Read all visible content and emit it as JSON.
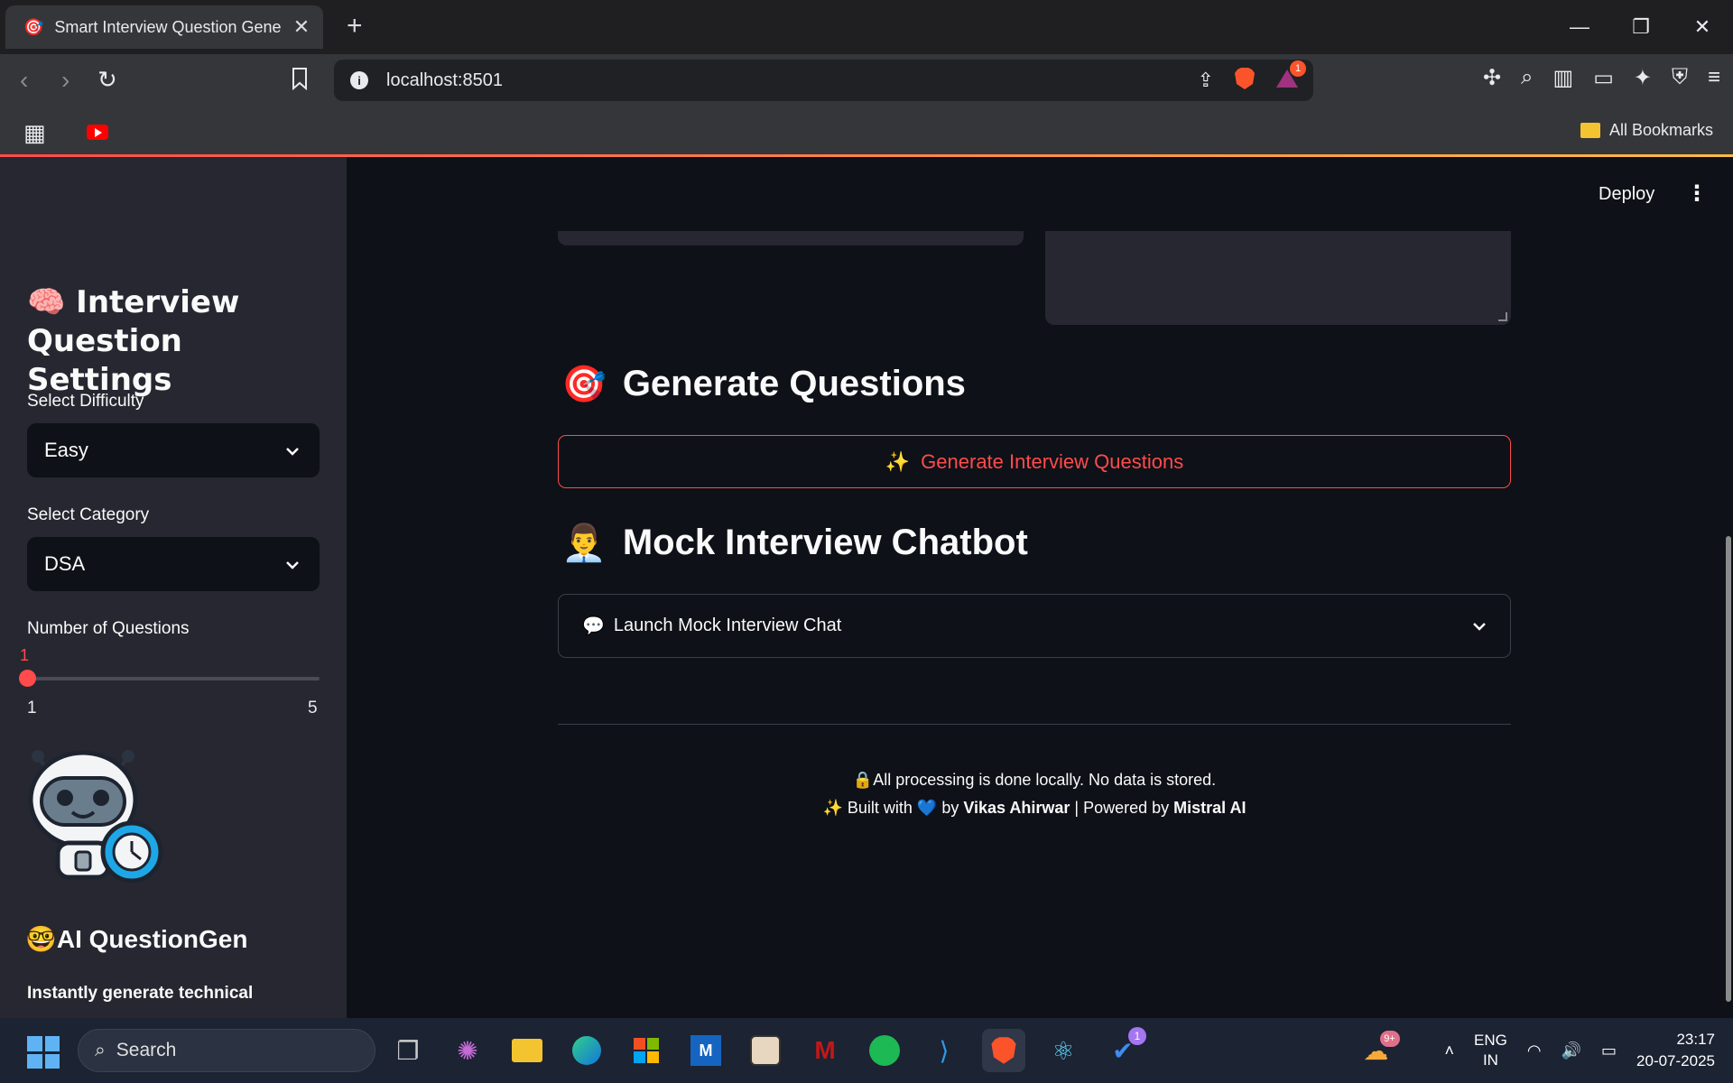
{
  "browser": {
    "tab_title": "Smart Interview Question Genera",
    "url": "localhost:8501",
    "bookmarks_all": "All Bookmarks",
    "brave_badge": "1"
  },
  "app": {
    "deploy_label": "Deploy",
    "sidebar": {
      "title": "🧠 Interview Question Settings",
      "difficulty_label": "Select Difficulty",
      "difficulty_value": "Easy",
      "category_label": "Select Category",
      "category_value": "DSA",
      "num_label": "Number of Questions",
      "num_value": "1",
      "num_min": "1",
      "num_max": "5",
      "brand": "🤓AI QuestionGen",
      "description": "Instantly generate technical"
    },
    "main": {
      "generate_heading": "Generate Questions",
      "generate_icon": "🎯",
      "generate_button": "Generate Interview Questions",
      "generate_button_icon": "✨",
      "mock_heading": "Mock Interview Chatbot",
      "mock_icon": "👨‍💼",
      "expander_label": "Launch Mock Interview Chat",
      "expander_icon": "💬",
      "footer_line1": "🔒All processing is done locally. No data is stored.",
      "footer_built": "✨ Built with  💙  by ",
      "footer_author": "Vikas Ahirwar",
      "footer_powered": " | Powered by ",
      "footer_ai": "Mistral AI"
    }
  },
  "taskbar": {
    "search_placeholder": "Search",
    "lang_top": "ENG",
    "lang_bottom": "IN",
    "time": "23:17",
    "date": "20-07-2025",
    "notif_badge": "9+",
    "app_badge": "1"
  },
  "colors": {
    "accent": "#ff4b4b",
    "sidebar_bg": "#262730",
    "main_bg": "#0e1117"
  }
}
